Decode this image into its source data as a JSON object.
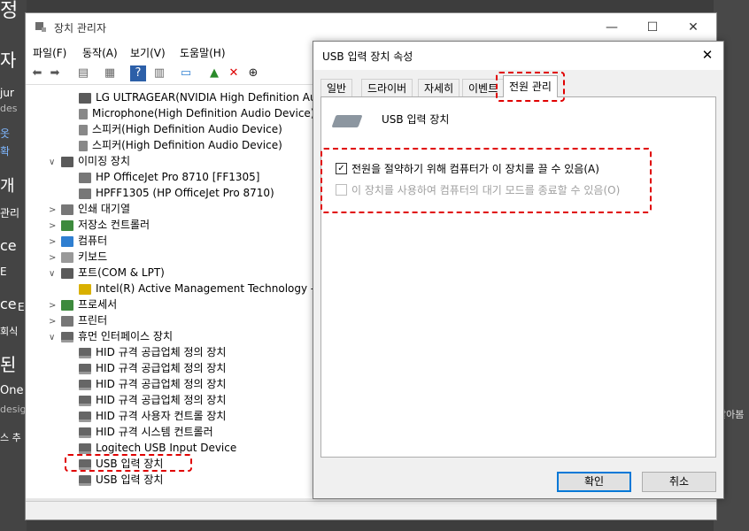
{
  "background": {
    "left_fragments": [
      "정",
      "자",
      "jur",
      "des",
      "옷",
      "확",
      "개",
      "관리",
      "ce",
      "E",
      "ce",
      "E",
      "회식",
      "된",
      "One",
      "desig",
      "스 추"
    ],
    "right_fragments": [
      "알아봄"
    ]
  },
  "device_manager": {
    "title": "장치 관리자",
    "window_controls": {
      "minimize": "—",
      "maximize": "☐",
      "close": "✕"
    },
    "menu": [
      "파일(F)",
      "동작(A)",
      "보기(V)",
      "도움말(H)"
    ],
    "tree": [
      {
        "label": "LG ULTRAGEAR(NVIDIA High Definition Audi",
        "level": 2,
        "icon": "monitor-icon"
      },
      {
        "label": "Microphone(High Definition Audio Device)",
        "level": 2,
        "icon": "microphone-icon"
      },
      {
        "label": "스피커(High Definition Audio Device)",
        "level": 2,
        "icon": "speaker-icon"
      },
      {
        "label": "스피커(High Definition Audio Device)",
        "level": 2,
        "icon": "speaker-icon"
      },
      {
        "label": "이미징 장치",
        "level": 1,
        "expanded": true,
        "icon": "camera-icon"
      },
      {
        "label": "HP OfficeJet Pro 8710 [FF1305]",
        "level": 2,
        "icon": "scanner-icon"
      },
      {
        "label": "HPFF1305 (HP OfficeJet Pro 8710)",
        "level": 2,
        "icon": "scanner-icon"
      },
      {
        "label": "인쇄 대기열",
        "level": 1,
        "expanded": false,
        "icon": "print-queue-icon"
      },
      {
        "label": "저장소 컨트롤러",
        "level": 1,
        "expanded": false,
        "icon": "storage-icon"
      },
      {
        "label": "컴퓨터",
        "level": 1,
        "expanded": false,
        "icon": "computer-icon"
      },
      {
        "label": "키보드",
        "level": 1,
        "expanded": false,
        "icon": "keyboard-icon"
      },
      {
        "label": "포트(COM & LPT)",
        "level": 1,
        "expanded": true,
        "icon": "port-icon"
      },
      {
        "label": "Intel(R) Active Management Technology - SO",
        "level": 2,
        "icon": "warning-icon"
      },
      {
        "label": "프로세서",
        "level": 1,
        "expanded": false,
        "icon": "processor-icon"
      },
      {
        "label": "프린터",
        "level": 1,
        "expanded": false,
        "icon": "printer-icon"
      },
      {
        "label": "휴먼 인터페이스 장치",
        "level": 1,
        "expanded": true,
        "icon": "hid-icon"
      },
      {
        "label": "HID 규격 공급업체 정의 장치",
        "level": 2,
        "icon": "hid-icon"
      },
      {
        "label": "HID 규격 공급업체 정의 장치",
        "level": 2,
        "icon": "hid-icon"
      },
      {
        "label": "HID 규격 공급업체 정의 장치",
        "level": 2,
        "icon": "hid-icon"
      },
      {
        "label": "HID 규격 공급업체 정의 장치",
        "level": 2,
        "icon": "hid-icon"
      },
      {
        "label": "HID 규격 사용자 컨트롤 장치",
        "level": 2,
        "icon": "hid-icon"
      },
      {
        "label": "HID 규격 시스템 컨트롤러",
        "level": 2,
        "icon": "hid-icon"
      },
      {
        "label": "Logitech USB Input Device",
        "level": 2,
        "icon": "hid-icon"
      },
      {
        "label": "USB 입력 장치",
        "level": 2,
        "icon": "hid-icon",
        "highlighted": true
      },
      {
        "label": "USB 입력 장치",
        "level": 2,
        "icon": "hid-icon"
      }
    ]
  },
  "dialog": {
    "title": "USB 입력 장치 속성",
    "close": "✕",
    "tabs": [
      "일반",
      "드라이버",
      "자세히",
      "이벤트",
      "전원 관리"
    ],
    "active_tab": "전원 관리",
    "device_name": "USB 입력 장치",
    "options": [
      {
        "label": "전원을 절약하기 위해 컴퓨터가 이 장치를 끌 수 있음(A)",
        "checked": true,
        "enabled": true
      },
      {
        "label": "이 장치를 사용하여 컴퓨터의 대기 모드를 종료할 수 있음(O)",
        "checked": false,
        "enabled": false
      }
    ],
    "ok_label": "확인",
    "cancel_label": "취소"
  },
  "colors": {
    "highlight": "#e00000",
    "default_button_border": "#0078d7"
  }
}
